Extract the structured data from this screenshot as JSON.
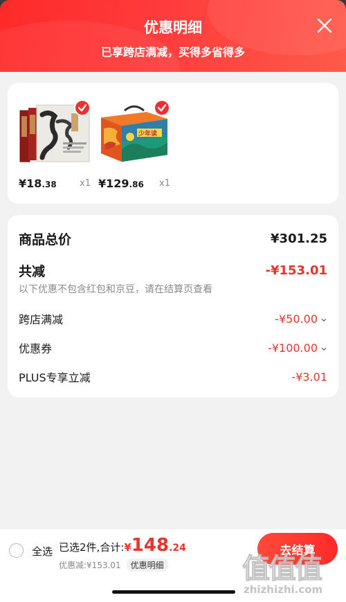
{
  "header": {
    "title": "优惠明细",
    "subtitle": "已享跨店满减，买得多省得多"
  },
  "products": [
    {
      "price_int": "¥18",
      "price_dec": ".38",
      "qty": "x1",
      "thumb_icon": "book-set-thumbnail",
      "checked": true
    },
    {
      "price_int": "¥129",
      "price_dec": ".86",
      "qty": "x1",
      "thumb_icon": "gift-box-thumbnail",
      "checked": true
    }
  ],
  "summary": {
    "total_label": "商品总价",
    "total_value": "¥301.25",
    "reduce_label": "共减",
    "reduce_value": "-¥153.01",
    "note": "以下优惠不包含红包和京豆，请在结算页查看",
    "items": [
      {
        "label": "跨店满减",
        "value": "-¥50.00",
        "has_chevron": true
      },
      {
        "label": "优惠券",
        "value": "-¥100.00",
        "has_chevron": true
      },
      {
        "label": "PLUS专享立减",
        "value": "-¥3.01",
        "has_chevron": false
      }
    ]
  },
  "bottom": {
    "select_all": "全选",
    "selected": "已选2件,",
    "total_label": "合计:",
    "total_yen": "¥",
    "total_int": "148",
    "total_dec": ".24",
    "discount": "优惠减:¥153.01",
    "detail_tag": "优惠明细",
    "checkout": "去结算"
  },
  "watermark": {
    "zh": "值值值",
    "en": "zhizhizhi.com"
  },
  "colors": {
    "accent": "#ff2a2a",
    "price_red": "#e6352b",
    "muted": "#8a8a8a"
  }
}
